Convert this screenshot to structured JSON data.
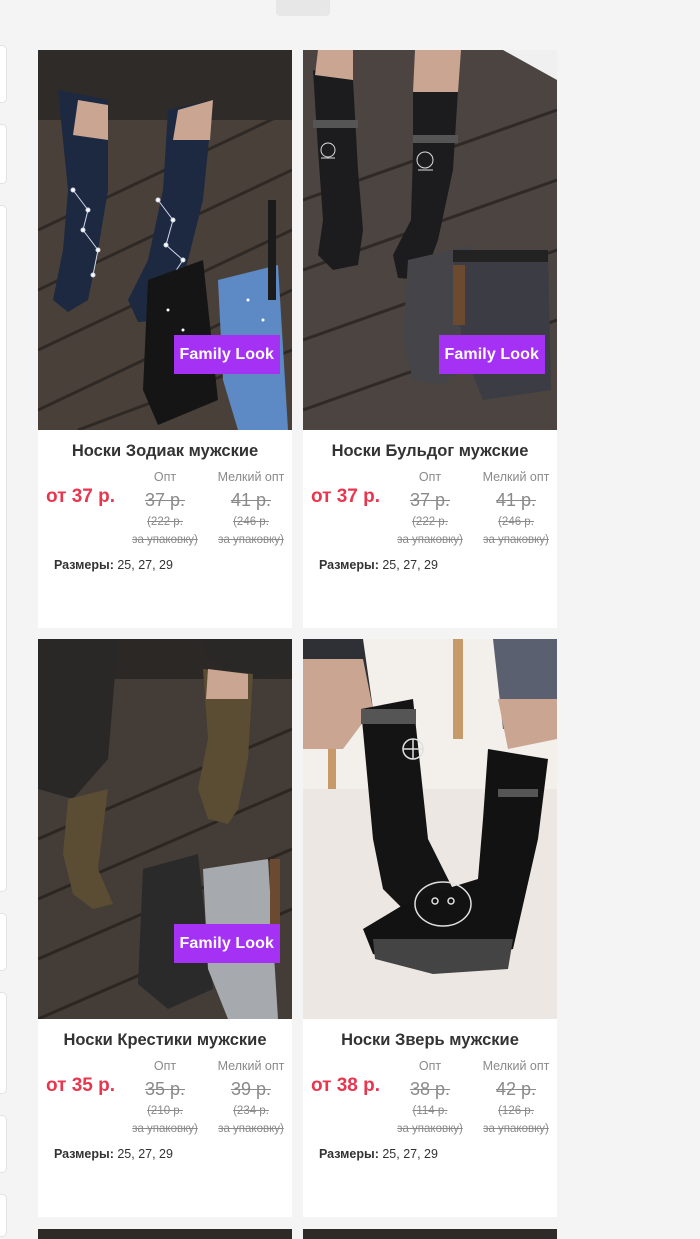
{
  "labels": {
    "family_look": "Family Look",
    "opt": "Опт",
    "melkiy_opt": "Мелкий опт",
    "sizes_label": "Размеры:"
  },
  "products": [
    {
      "title": "Носки Зодиак мужские",
      "from_price": "от 37 р.",
      "opt_price": "37 р.",
      "opt_pack_line1": "(222 р.",
      "opt_pack_line2": "за упаковку)",
      "melk_price": "41 р.",
      "melk_pack_line1": "(246 р.",
      "melk_pack_line2": "за упаковку)",
      "sizes": "25, 27, 29",
      "badge": true
    },
    {
      "title": "Носки Бульдог мужские",
      "from_price": "от 37 р.",
      "opt_price": "37 р.",
      "opt_pack_line1": "(222 р.",
      "opt_pack_line2": "за упаковку)",
      "melk_price": "41 р.",
      "melk_pack_line1": "(246 р.",
      "melk_pack_line2": "за упаковку)",
      "sizes": "25, 27, 29",
      "badge": true
    },
    {
      "title": "Носки Крестики мужские",
      "from_price": "от 35 р.",
      "opt_price": "35 р.",
      "opt_pack_line1": "(210 р.",
      "opt_pack_line2": "за упаковку)",
      "melk_price": "39 р.",
      "melk_pack_line1": "(234 р.",
      "melk_pack_line2": "за упаковку)",
      "sizes": "25, 27, 29",
      "badge": true
    },
    {
      "title": "Носки Зверь мужские",
      "from_price": "от 38 р.",
      "opt_price": "38 р.",
      "opt_pack_line1": "(114 р.",
      "opt_pack_line2": "за упаковку)",
      "melk_price": "42 р.",
      "melk_pack_line1": "(126 р.",
      "melk_pack_line2": "за упаковку)",
      "sizes": "25, 27, 29",
      "badge": false
    }
  ],
  "colors": {
    "accent_price": "#e8364f",
    "badge_bg": "#a531f5",
    "page_bg": "#f4f4f4"
  }
}
